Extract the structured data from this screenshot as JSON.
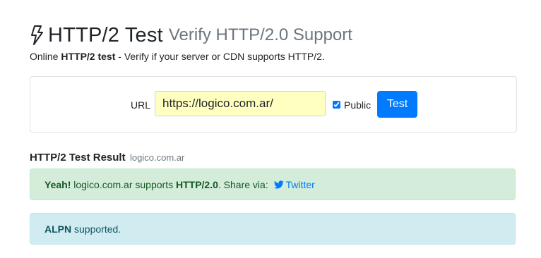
{
  "header": {
    "icon": "lightning-bolt-icon",
    "title": "HTTP/2 Test",
    "subtitle": "Verify HTTP/2.0 Support"
  },
  "lead": {
    "prefix": "Online ",
    "bold": "HTTP/2 test",
    "suffix": " - Verify if your server or CDN supports HTTP/2."
  },
  "form": {
    "url_label": "URL",
    "url_value": "https://logico.com.ar/",
    "public_checked": true,
    "public_label": "Public",
    "test_button_label": "Test"
  },
  "result": {
    "heading": "HTTP/2 Test Result",
    "domain": "logico.com.ar",
    "success": {
      "bold_prefix": "Yeah!",
      "text": " logico.com.ar supports ",
      "protocol": "HTTP/2.0",
      "share_text": ". Share via: ",
      "share_icon": "twitter-icon",
      "share_link": "Twitter"
    },
    "alpn": {
      "bold": "ALPN",
      "text": " supported."
    }
  },
  "colors": {
    "primary": "#007bff",
    "input_bg": "#ffffc0",
    "success_bg": "#d4edda",
    "success_text": "#155724",
    "info_bg": "#d1ecf1",
    "info_text": "#0c5460",
    "muted": "#6c757d"
  }
}
